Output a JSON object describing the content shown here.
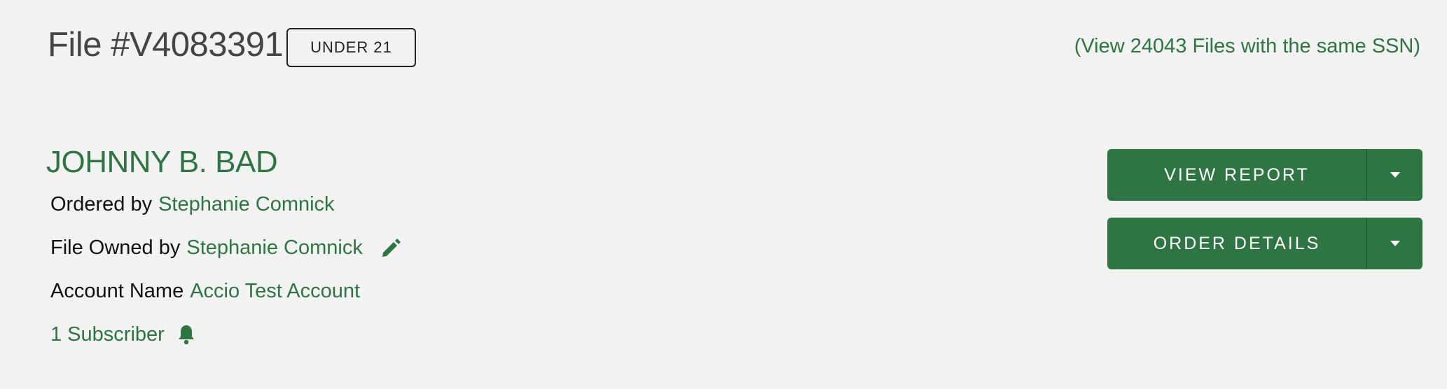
{
  "header": {
    "file_title": "File #V4083391",
    "age_badge": "UNDER 21",
    "same_ssn_link": "(View 24043 Files with the same SSN)"
  },
  "subject": {
    "name": "JOHNNY B. BAD",
    "ordered_by_label": "Ordered by",
    "ordered_by_value": "Stephanie Comnick",
    "owned_by_label": "File Owned by",
    "owned_by_value": "Stephanie Comnick",
    "account_label": "Account Name",
    "account_value": "Accio Test Account",
    "subscribers": "1 Subscriber"
  },
  "actions": {
    "view_report": "VIEW REPORT",
    "order_details": "ORDER DETAILS"
  },
  "icons": {
    "edit": "pencil-icon",
    "subscriber": "bell-icon",
    "dropdown": "caret-down-icon"
  },
  "colors": {
    "brand_green": "#2f7543",
    "background": "#f2f2f2",
    "title_gray": "#454545"
  }
}
